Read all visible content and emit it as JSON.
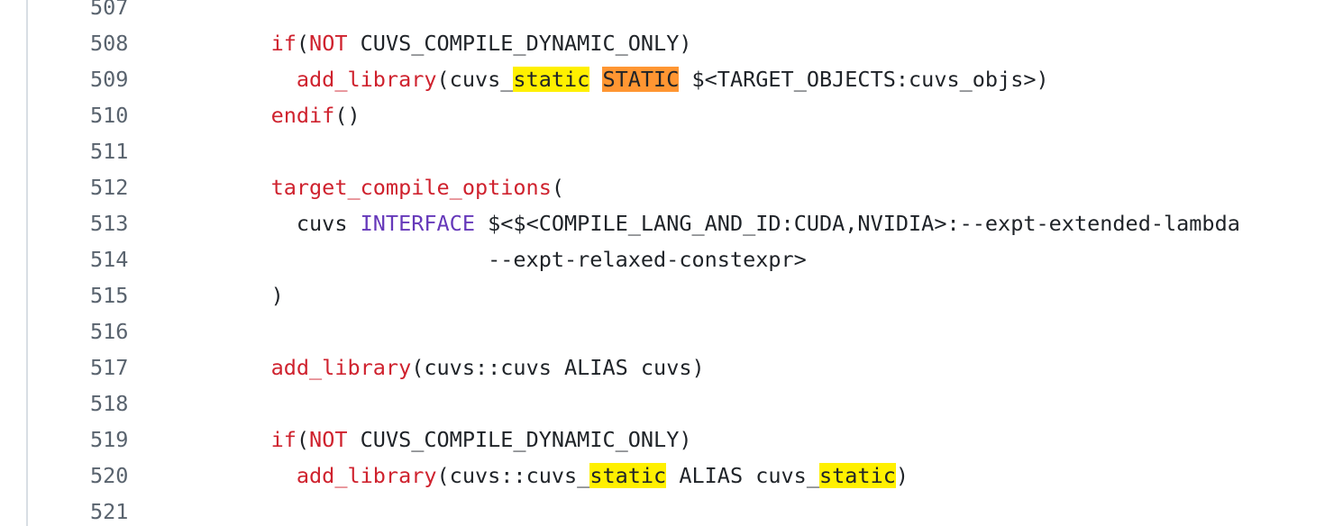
{
  "code_viewer": {
    "lines": [
      {
        "number": "507",
        "tokens": []
      },
      {
        "number": "508",
        "tokens": [
          {
            "t": "    ",
            "c": ""
          },
          {
            "t": "if",
            "c": "kw"
          },
          {
            "t": "(",
            "c": ""
          },
          {
            "t": "NOT",
            "c": "kw"
          },
          {
            "t": " CUVS_COMPILE_DYNAMIC_ONLY)",
            "c": ""
          }
        ]
      },
      {
        "number": "509",
        "tokens": [
          {
            "t": "      ",
            "c": ""
          },
          {
            "t": "add_library",
            "c": "kw"
          },
          {
            "t": "(cuvs_",
            "c": ""
          },
          {
            "t": "static",
            "c": "hl"
          },
          {
            "t": " ",
            "c": ""
          },
          {
            "t": "STATIC",
            "c": "hl-cur"
          },
          {
            "t": " $<TARGET_OBJECTS:cuvs_objs>)",
            "c": ""
          }
        ]
      },
      {
        "number": "510",
        "tokens": [
          {
            "t": "    ",
            "c": ""
          },
          {
            "t": "endif",
            "c": "kw"
          },
          {
            "t": "()",
            "c": ""
          }
        ]
      },
      {
        "number": "511",
        "tokens": []
      },
      {
        "number": "512",
        "tokens": [
          {
            "t": "    ",
            "c": ""
          },
          {
            "t": "target_compile_options",
            "c": "kw"
          },
          {
            "t": "(",
            "c": ""
          }
        ]
      },
      {
        "number": "513",
        "tokens": [
          {
            "t": "      cuvs ",
            "c": ""
          },
          {
            "t": "INTERFACE",
            "c": "kw2"
          },
          {
            "t": " $<$<COMPILE_LANG_AND_ID:CUDA,NVIDIA>:--expt-extended-lambda",
            "c": ""
          }
        ]
      },
      {
        "number": "514",
        "tokens": [
          {
            "t": "                     --expt-relaxed-constexpr>",
            "c": ""
          }
        ]
      },
      {
        "number": "515",
        "tokens": [
          {
            "t": "    )",
            "c": ""
          }
        ]
      },
      {
        "number": "516",
        "tokens": []
      },
      {
        "number": "517",
        "tokens": [
          {
            "t": "    ",
            "c": ""
          },
          {
            "t": "add_library",
            "c": "kw"
          },
          {
            "t": "(cuvs::cuvs ALIAS cuvs)",
            "c": ""
          }
        ]
      },
      {
        "number": "518",
        "tokens": []
      },
      {
        "number": "519",
        "tokens": [
          {
            "t": "    ",
            "c": ""
          },
          {
            "t": "if",
            "c": "kw"
          },
          {
            "t": "(",
            "c": ""
          },
          {
            "t": "NOT",
            "c": "kw"
          },
          {
            "t": " CUVS_COMPILE_DYNAMIC_ONLY)",
            "c": ""
          }
        ]
      },
      {
        "number": "520",
        "tokens": [
          {
            "t": "      ",
            "c": ""
          },
          {
            "t": "add_library",
            "c": "kw"
          },
          {
            "t": "(cuvs::cuvs_",
            "c": ""
          },
          {
            "t": "static",
            "c": "hl"
          },
          {
            "t": " ALIAS cuvs_",
            "c": ""
          },
          {
            "t": "static",
            "c": "hl"
          },
          {
            "t": ")",
            "c": ""
          }
        ]
      },
      {
        "number": "521",
        "tokens": []
      }
    ]
  },
  "colors": {
    "keyword": "#cf222e",
    "keyword_secondary": "#6639ba",
    "search_match": "#fff000",
    "current_match": "#ff9632",
    "line_number": "#59636e"
  }
}
